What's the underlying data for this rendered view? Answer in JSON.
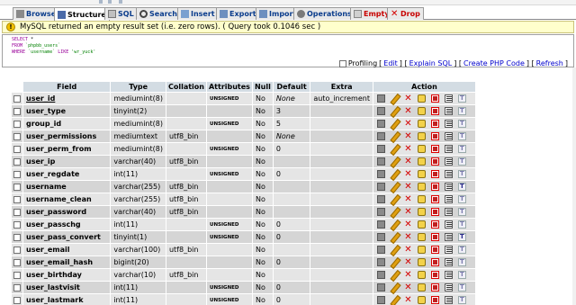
{
  "tabs": [
    {
      "label": "Browse",
      "icon": "browse-icon",
      "active": false
    },
    {
      "label": "Structure",
      "icon": "structure-icon",
      "active": true
    },
    {
      "label": "SQL",
      "icon": "sql-icon",
      "active": false
    },
    {
      "label": "Search",
      "icon": "search-icon",
      "active": false
    },
    {
      "label": "Insert",
      "icon": "insert-icon",
      "active": false
    },
    {
      "label": "Export",
      "icon": "export-icon",
      "active": false
    },
    {
      "label": "Import",
      "icon": "import-icon",
      "active": false
    },
    {
      "label": "Operations",
      "icon": "operations-icon",
      "active": false
    },
    {
      "label": "Empty",
      "icon": "empty-icon",
      "active": false
    },
    {
      "label": "Drop",
      "icon": "drop-icon",
      "active": false
    }
  ],
  "message": {
    "text": "MySQL returned an empty result set (i.e. zero rows). ( Query took 0.1046 sec )",
    "icon": "warning-icon"
  },
  "sql": {
    "select_kw": "SELECT",
    "star": " *",
    "from_kw": "FROM",
    "table": " `phpbb_users`",
    "where_kw": "WHERE",
    "cond_field": " `username` ",
    "like_kw": "LIKE",
    "cond_value": " 'wr_yuck'",
    "profiling": "Profiling",
    "links": [
      "Edit",
      "Explain SQL",
      "Create PHP Code",
      "Refresh"
    ]
  },
  "columns": [
    "Field",
    "Type",
    "Collation",
    "Attributes",
    "Null",
    "Default",
    "Extra",
    "Action"
  ],
  "rows": [
    {
      "field": "user_id",
      "type": "mediumint(8)",
      "collation": "",
      "attributes": "UNSIGNED",
      "null": "No",
      "default": "None",
      "extra": "auto_increment",
      "pk": true
    },
    {
      "field": "user_type",
      "type": "tinyint(2)",
      "collation": "",
      "attributes": "",
      "null": "No",
      "default": "3",
      "extra": "",
      "pk": false
    },
    {
      "field": "group_id",
      "type": "mediumint(8)",
      "collation": "",
      "attributes": "UNSIGNED",
      "null": "No",
      "default": "5",
      "extra": "",
      "pk": false
    },
    {
      "field": "user_permissions",
      "type": "mediumtext",
      "collation": "utf8_bin",
      "attributes": "",
      "null": "No",
      "default": "None",
      "extra": "",
      "pk": false
    },
    {
      "field": "user_perm_from",
      "type": "mediumint(8)",
      "collation": "",
      "attributes": "UNSIGNED",
      "null": "No",
      "default": "0",
      "extra": "",
      "pk": false
    },
    {
      "field": "user_ip",
      "type": "varchar(40)",
      "collation": "utf8_bin",
      "attributes": "",
      "null": "No",
      "default": "",
      "extra": "",
      "pk": false
    },
    {
      "field": "user_regdate",
      "type": "int(11)",
      "collation": "",
      "attributes": "UNSIGNED",
      "null": "No",
      "default": "0",
      "extra": "",
      "pk": false
    },
    {
      "field": "username",
      "type": "varchar(255)",
      "collation": "utf8_bin",
      "attributes": "",
      "null": "No",
      "default": "",
      "extra": "",
      "pk": false
    },
    {
      "field": "username_clean",
      "type": "varchar(255)",
      "collation": "utf8_bin",
      "attributes": "",
      "null": "No",
      "default": "",
      "extra": "",
      "pk": false
    },
    {
      "field": "user_password",
      "type": "varchar(40)",
      "collation": "utf8_bin",
      "attributes": "",
      "null": "No",
      "default": "",
      "extra": "",
      "pk": false
    },
    {
      "field": "user_passchg",
      "type": "int(11)",
      "collation": "",
      "attributes": "UNSIGNED",
      "null": "No",
      "default": "0",
      "extra": "",
      "pk": false
    },
    {
      "field": "user_pass_convert",
      "type": "tinyint(1)",
      "collation": "",
      "attributes": "UNSIGNED",
      "null": "No",
      "default": "0",
      "extra": "",
      "pk": false
    },
    {
      "field": "user_email",
      "type": "varchar(100)",
      "collation": "utf8_bin",
      "attributes": "",
      "null": "No",
      "default": "",
      "extra": "",
      "pk": false
    },
    {
      "field": "user_email_hash",
      "type": "bigint(20)",
      "collation": "",
      "attributes": "",
      "null": "No",
      "default": "0",
      "extra": "",
      "pk": false
    },
    {
      "field": "user_birthday",
      "type": "varchar(10)",
      "collation": "utf8_bin",
      "attributes": "",
      "null": "No",
      "default": "",
      "extra": "",
      "pk": false
    },
    {
      "field": "user_lastvisit",
      "type": "int(11)",
      "collation": "",
      "attributes": "UNSIGNED",
      "null": "No",
      "default": "0",
      "extra": "",
      "pk": false
    },
    {
      "field": "user_lastmark",
      "type": "int(11)",
      "collation": "",
      "attributes": "UNSIGNED",
      "null": "No",
      "default": "0",
      "extra": "",
      "pk": false
    }
  ],
  "colors": {
    "header_bg": "#d3dce3",
    "row_odd": "#e5e5e5",
    "row_even": "#d5d5d5",
    "message_bg": "#ffffcc",
    "link": "#0000cc",
    "danger": "#c80000"
  }
}
